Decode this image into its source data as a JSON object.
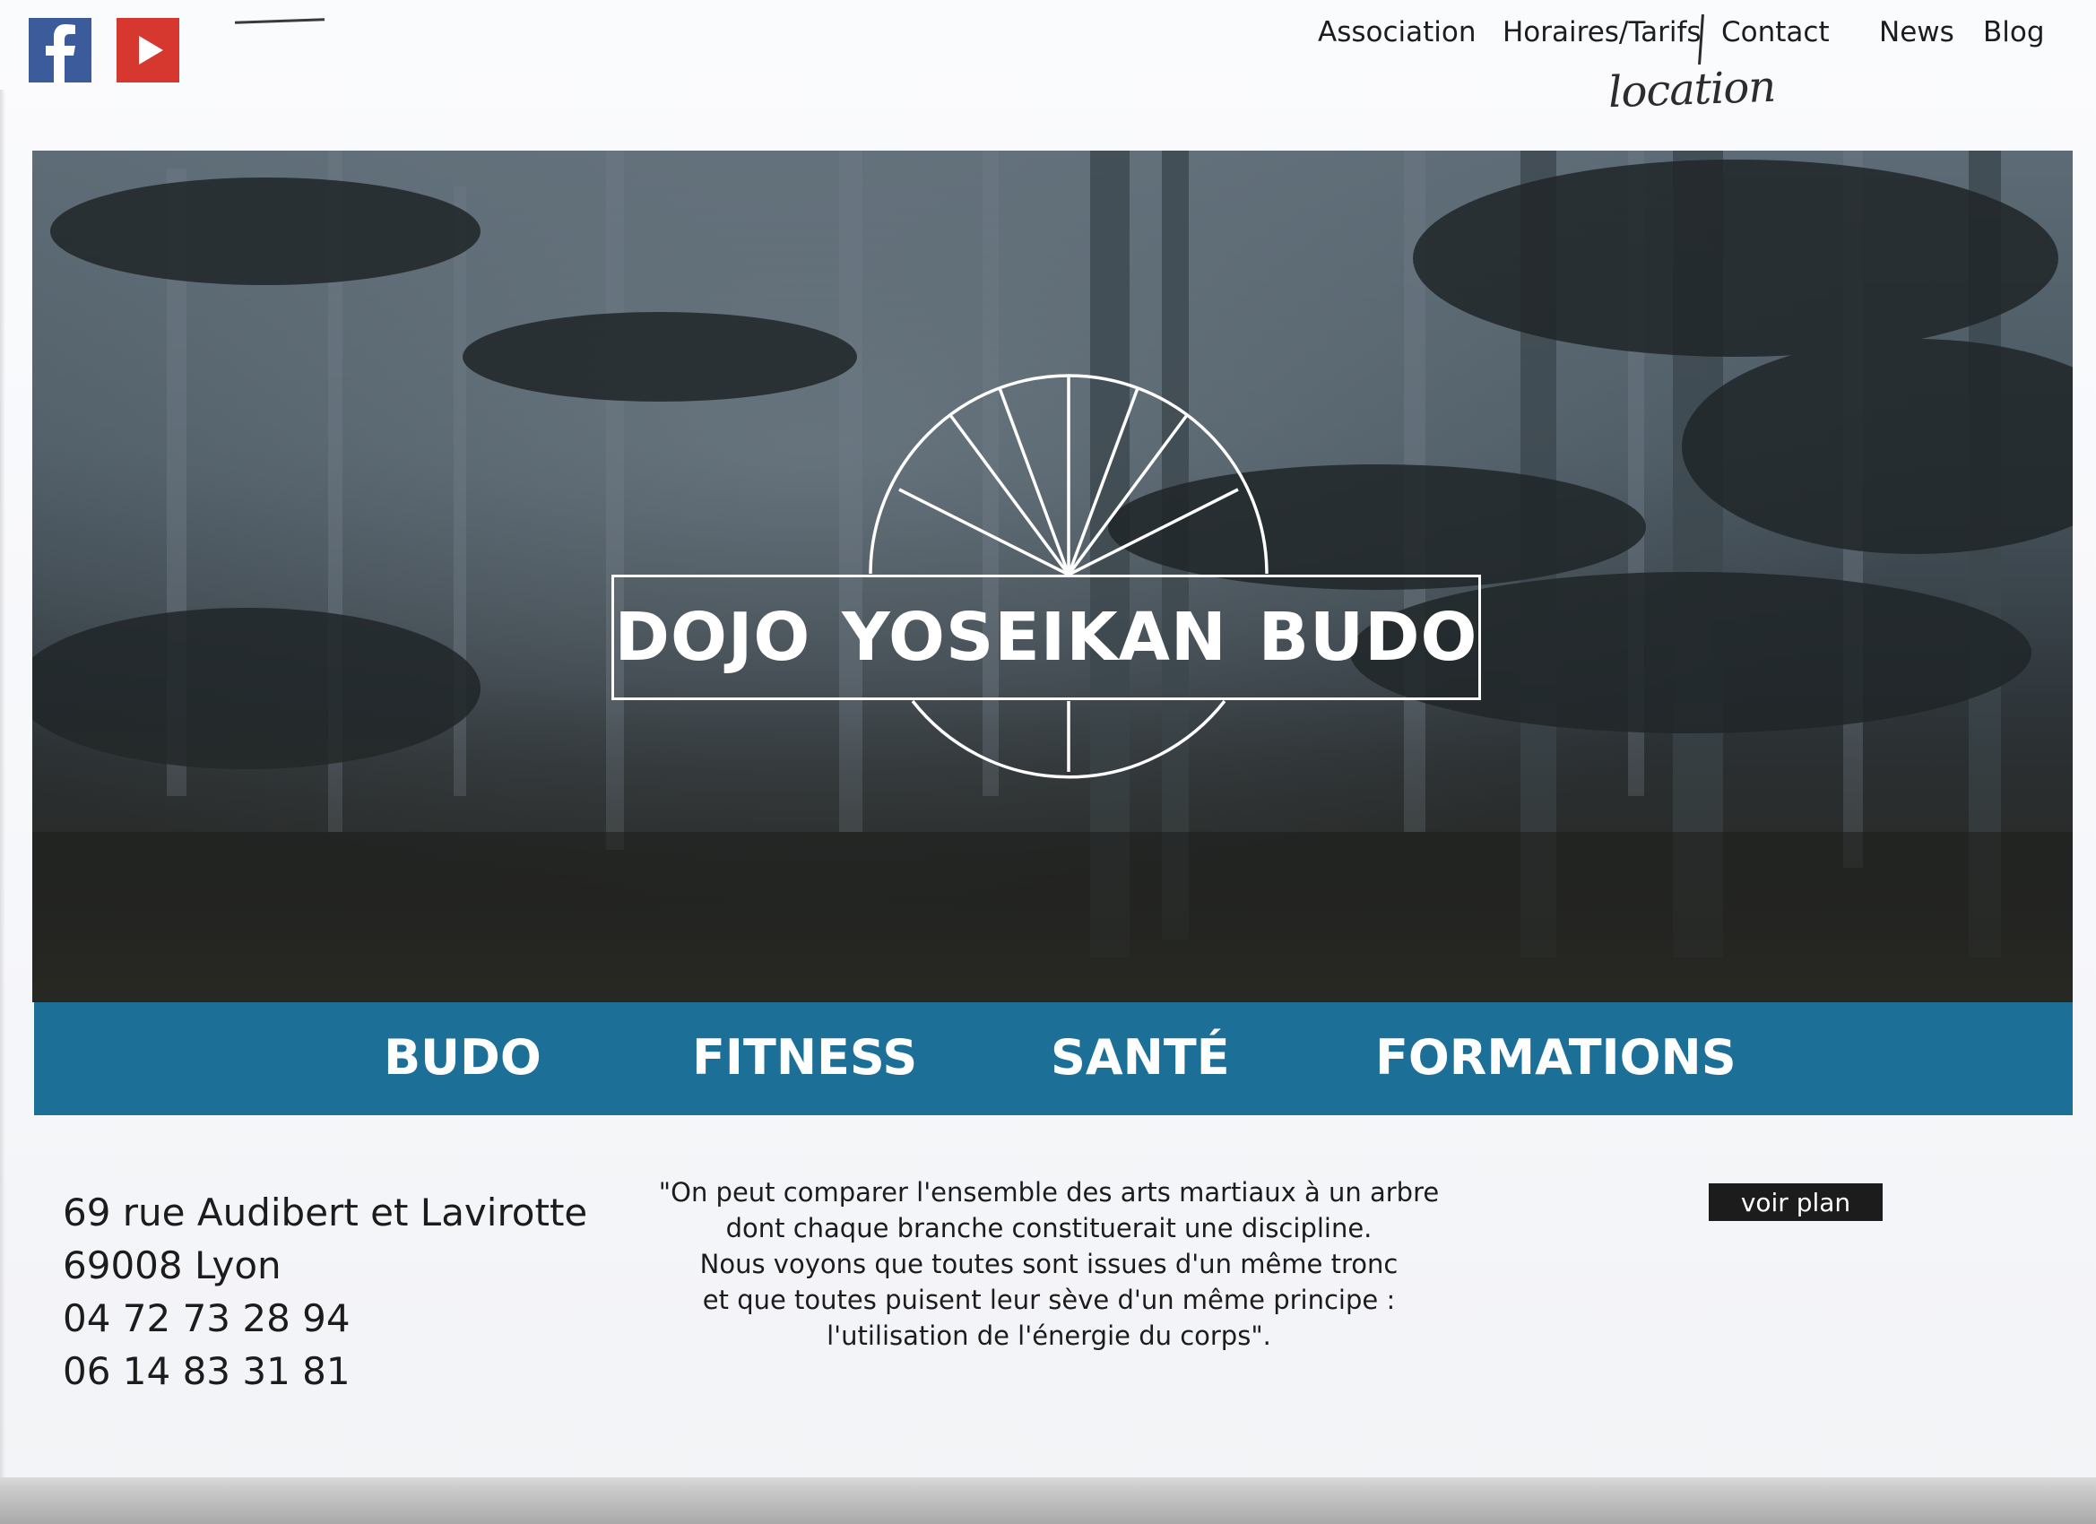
{
  "header": {
    "social": [
      {
        "name": "facebook-icon",
        "color": "#3b5b9a"
      },
      {
        "name": "youtube-icon",
        "color": "#d6382f"
      }
    ],
    "nav": [
      "Association",
      "Horaires/Tarifs",
      "Contact",
      "News",
      "Blog"
    ],
    "handwritten_note": "location"
  },
  "hero": {
    "logo_text": "DOJO YOSEIKAN BUDO"
  },
  "categories": {
    "color": "#1c6f97",
    "items": [
      "BUDO",
      "FITNESS",
      "SANTÉ",
      "FORMATIONS"
    ]
  },
  "contact": {
    "street": "69 rue Audibert et Lavirotte",
    "city": "69008 Lyon",
    "phone1": "04 72 73 28 94",
    "phone2": "06 14 83 31 81"
  },
  "quote": {
    "lines": [
      "\"On peut comparer l'ensemble des arts martiaux à un arbre",
      "dont chaque branche constituerait une discipline.",
      "Nous voyons que toutes sont issues d'un même tronc",
      "et que toutes puisent leur sève d'un même principe :",
      "l'utilisation de l'énergie du corps\"."
    ]
  },
  "map_button": "voir plan"
}
